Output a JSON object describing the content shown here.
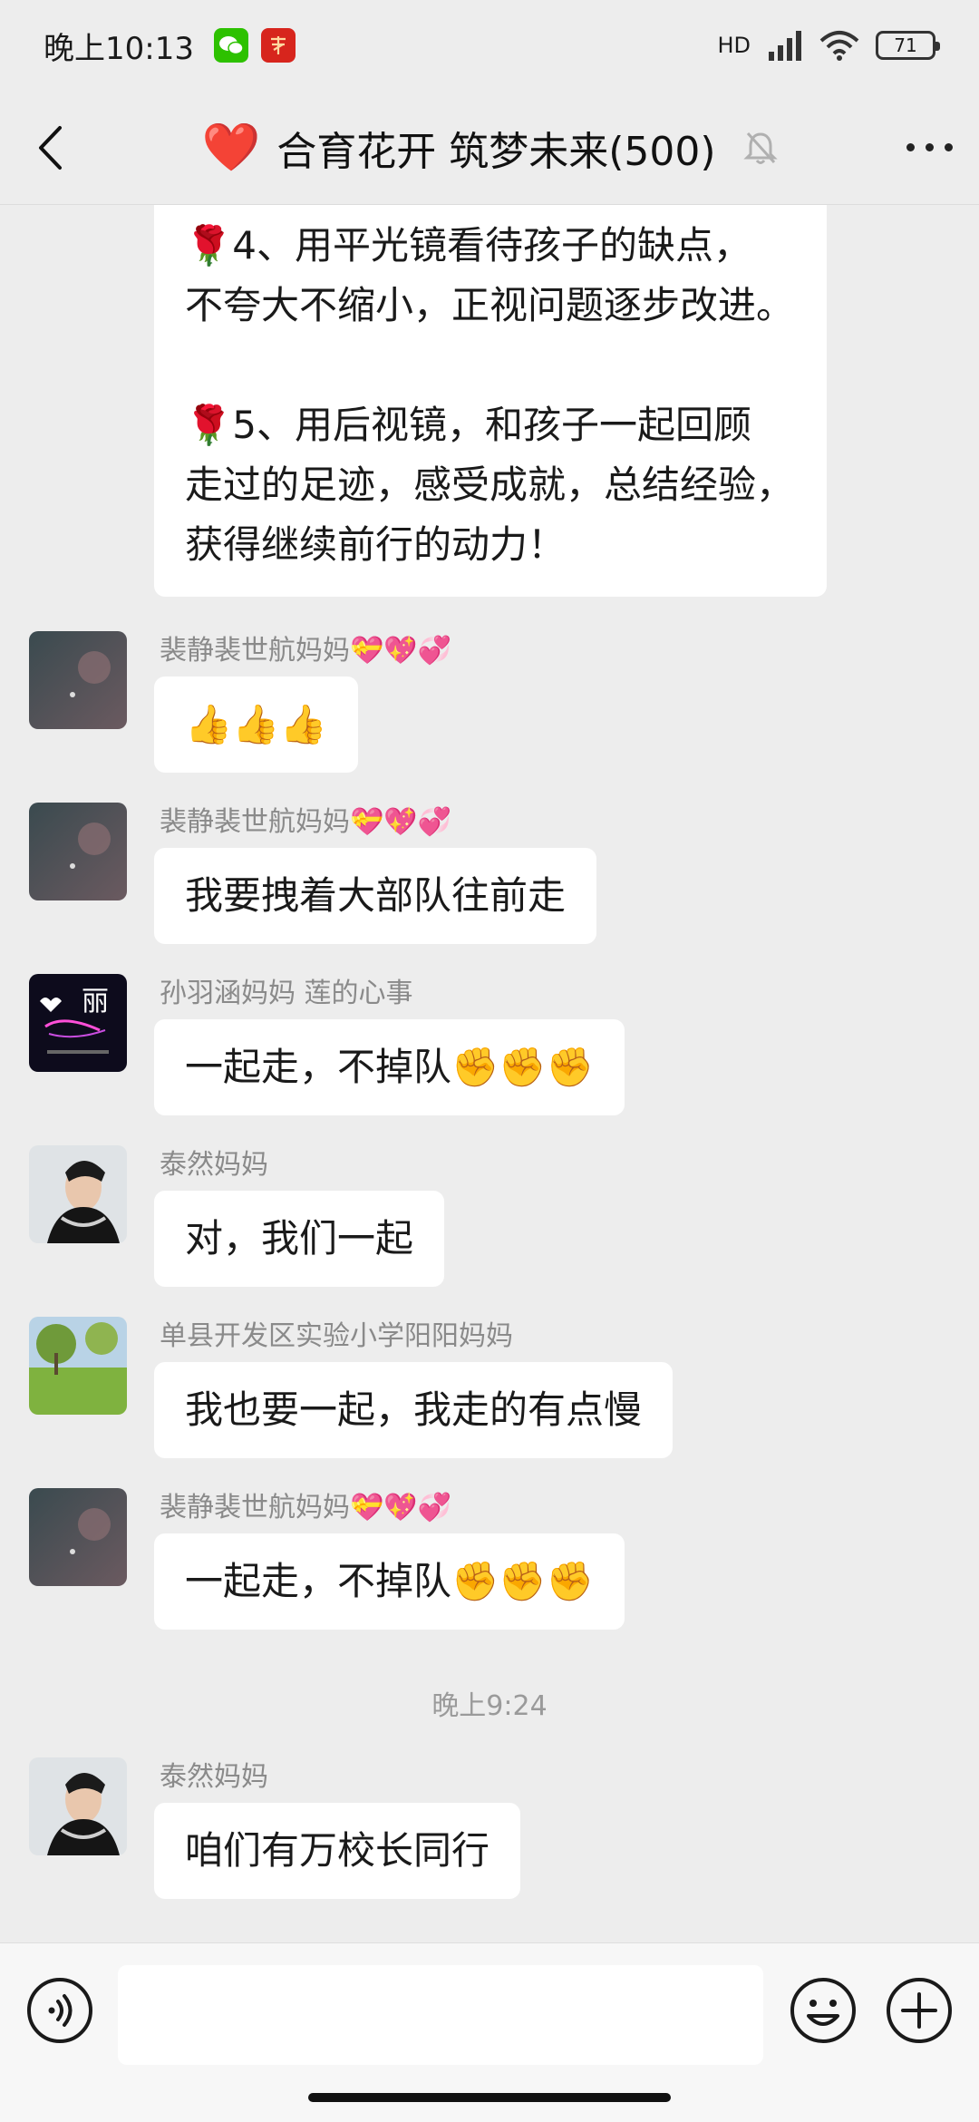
{
  "status": {
    "time": "晚上10:13",
    "network": "HD",
    "battery": "71"
  },
  "header": {
    "heart": "❤️",
    "title": "合育花开 筑梦未来(500)"
  },
  "top_message": {
    "text": "🌹4、用平光镜看待孩子的缺点，\n不夸大不缩小，正视问题逐步改进。\n\n🌹5、用后视镜，和孩子一起回顾\n走过的足迹，感受成就，总结经验，\n获得继续前行的动力！"
  },
  "messages": [
    {
      "sender": "裴静裴世航妈妈💝💖💞",
      "text": "👍👍👍"
    },
    {
      "sender": "裴静裴世航妈妈💝💖💞",
      "text": "我要拽着大部队往前走"
    },
    {
      "sender": "孙羽涵妈妈  莲的心事",
      "text": "一起走，不掉队✊✊✊"
    },
    {
      "sender": "泰然妈妈",
      "text": "对，我们一起"
    },
    {
      "sender": "单县开发区实验小学阳阳妈妈",
      "text": "我也要一起，我走的有点慢"
    },
    {
      "sender": "裴静裴世航妈妈💝💖💞",
      "text": "一起走，不掉队✊✊✊"
    },
    {
      "sender": "泰然妈妈",
      "text": "咱们有万校长同行"
    }
  ],
  "time_separator": "晚上9:24",
  "avatar_text": "丽",
  "input": {
    "value": ""
  }
}
